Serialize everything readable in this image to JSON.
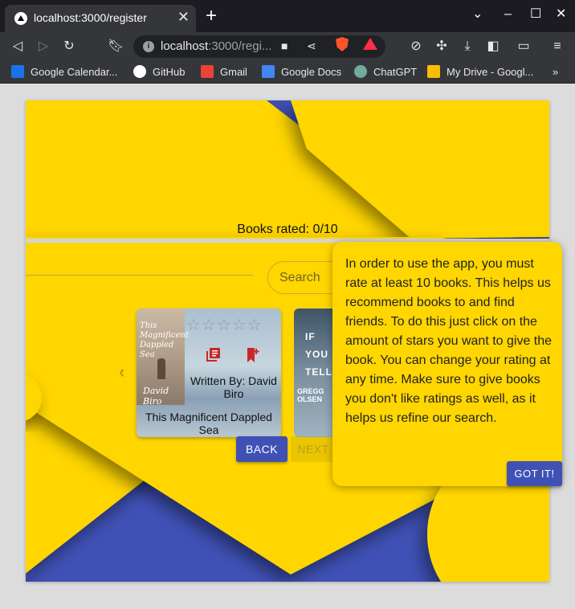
{
  "browser": {
    "tab_title": "localhost:3000/register",
    "tab_close": "✕",
    "new_tab": "+",
    "window_controls": {
      "minimize": "–",
      "maximize": "☐",
      "close": "✕",
      "tab_list": "⌄"
    },
    "address": {
      "host": "localhost",
      "path": ":3000/regi..."
    },
    "toolbar_icons": [
      "back-icon",
      "forward-icon",
      "reload-icon",
      "bookmark-icon",
      "camera-icon",
      "share-icon",
      "brave-shield-icon",
      "brave-rewards-icon",
      "compass-icon",
      "extensions-icon",
      "download-icon",
      "sidebar-icon",
      "wallet-icon",
      "menu-icon"
    ],
    "bookmarks": [
      {
        "label": "Google Calendar...",
        "icon": "calendar-icon",
        "color": "#1a73e8"
      },
      {
        "label": "GitHub",
        "icon": "github-icon",
        "color": "#ffffff"
      },
      {
        "label": "Gmail",
        "icon": "gmail-icon",
        "color": "#ea4335"
      },
      {
        "label": "Google Docs",
        "icon": "docs-icon",
        "color": "#4285f4"
      },
      {
        "label": "ChatGPT",
        "icon": "chatgpt-icon",
        "color": "#74aa9c"
      },
      {
        "label": "My Drive - Googl...",
        "icon": "drive-icon",
        "color": "#fbbc04"
      }
    ],
    "bookmarks_overflow": "»"
  },
  "app": {
    "books_rated": "Books rated: 0/10",
    "search_placeholder": "Search",
    "carousel_prev": "‹",
    "book": {
      "cover_title": "This Magnificent Dappled Sea",
      "cover_author": "David Biro",
      "stars": "☆☆☆☆☆",
      "written_by": "Written By: David Biro",
      "title": "This Magnificent Dappled Sea"
    },
    "book2": {
      "cover_lines": "IF\nYOU\nTELL",
      "cover_author": "GREGG OLSEN"
    },
    "buttons": {
      "back": "BACK",
      "next": "NEXT"
    },
    "colors": {
      "yellow": "#ffd600",
      "blue": "#3f51b5",
      "icon_red": "#c62828"
    }
  },
  "tooltip": {
    "text": "In order to use the app, you must rate at least 10 books. This helps us recommend books to and find friends. To do this just click on the amount of stars you want to give the book. You can change your rating at any time. Make sure to give books you don't like ratings as well, as it helps us refine our search.",
    "button": "GOT IT!"
  }
}
